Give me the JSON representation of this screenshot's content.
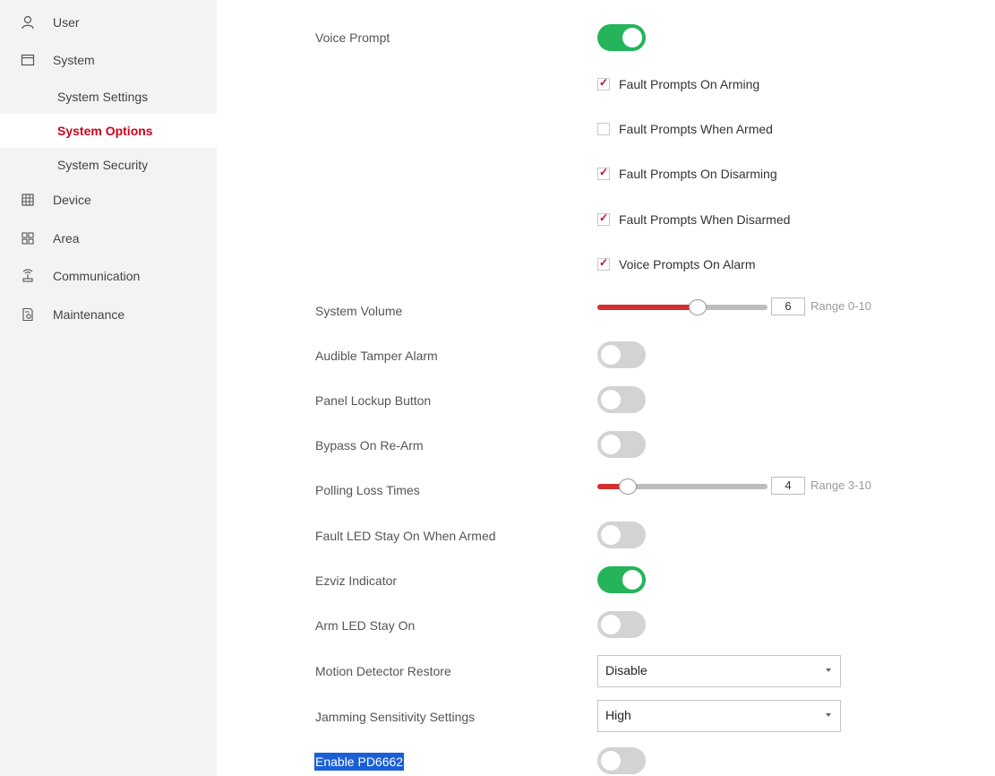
{
  "sidebar": {
    "items": [
      {
        "label": "User",
        "icon": "user-icon"
      },
      {
        "label": "System",
        "icon": "window-icon"
      },
      {
        "label": "Device",
        "icon": "device-icon"
      },
      {
        "label": "Area",
        "icon": "grid-icon"
      },
      {
        "label": "Communication",
        "icon": "antenna-icon"
      },
      {
        "label": "Maintenance",
        "icon": "maintenance-icon"
      }
    ],
    "system_children": [
      {
        "label": "System Settings"
      },
      {
        "label": "System Options",
        "active": true
      },
      {
        "label": "System Security"
      }
    ]
  },
  "settings": {
    "voice_prompt": {
      "label": "Voice Prompt",
      "on": true
    },
    "voice_options": [
      {
        "label": "Fault Prompts On Arming",
        "checked": true
      },
      {
        "label": "Fault Prompts When Armed",
        "checked": false
      },
      {
        "label": "Fault Prompts On Disarming",
        "checked": true
      },
      {
        "label": "Fault Prompts When Disarmed",
        "checked": true
      },
      {
        "label": "Voice Prompts On Alarm",
        "checked": true
      }
    ],
    "system_volume": {
      "label": "System Volume",
      "value": "6",
      "min": 0,
      "max": 10,
      "range_text": "Range 0-10"
    },
    "audible_tamper_alarm": {
      "label": "Audible Tamper Alarm",
      "on": false
    },
    "panel_lockup_button": {
      "label": "Panel Lockup Button",
      "on": false
    },
    "bypass_on_rearm": {
      "label": "Bypass On Re-Arm",
      "on": false
    },
    "polling_loss_times": {
      "label": "Polling Loss Times",
      "value": "4",
      "min": 3,
      "max": 10,
      "range_text": "Range 3-10"
    },
    "fault_led_stay_on": {
      "label": "Fault LED Stay On When Armed",
      "on": false
    },
    "ezviz_indicator": {
      "label": "Ezviz Indicator",
      "on": true
    },
    "arm_led_stay_on": {
      "label": "Arm LED Stay On",
      "on": false
    },
    "motion_detector_restore": {
      "label": "Motion Detector Restore",
      "value": "Disable"
    },
    "jamming_sensitivity": {
      "label": "Jamming Sensitivity Settings",
      "value": "High"
    },
    "enable_pd6662": {
      "label": "Enable PD6662",
      "on": false
    }
  },
  "colors": {
    "accent_red": "#d0021b",
    "toggle_on": "#25b45a",
    "toggle_off": "#d3d3d3",
    "selection": "#1a5fd6"
  }
}
